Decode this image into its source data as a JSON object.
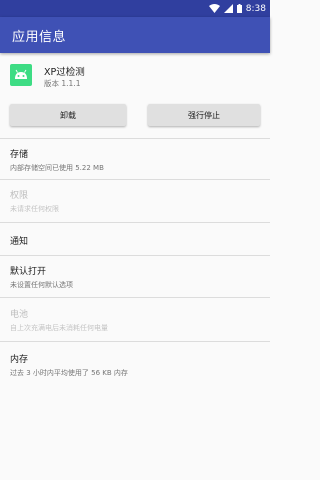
{
  "status_bar": {
    "time": "8:38"
  },
  "app_bar": {
    "title": "应用信息"
  },
  "app": {
    "name": "XP过检测",
    "version": "版本 1.1.1",
    "icon": "android-icon"
  },
  "buttons": {
    "uninstall": "卸载",
    "force_stop": "强行停止"
  },
  "sections": {
    "storage": {
      "title": "存储",
      "subtitle": "内部存储空间已使用 5.22 MB"
    },
    "permissions": {
      "title": "权限",
      "subtitle": "未请求任何权限"
    },
    "notifications": {
      "title": "通知"
    },
    "open_by_default": {
      "title": "默认打开",
      "subtitle": "未设置任何默认选项"
    },
    "battery": {
      "title": "电池",
      "subtitle": "自上次充满电后未消耗任何电量"
    },
    "memory": {
      "title": "内存",
      "subtitle": "过去 3 小时内平均使用了 56 KB 内存"
    }
  },
  "colors": {
    "status_bar": "#303f9f",
    "app_bar": "#3f51b5",
    "android_green": "#3ddc84"
  }
}
